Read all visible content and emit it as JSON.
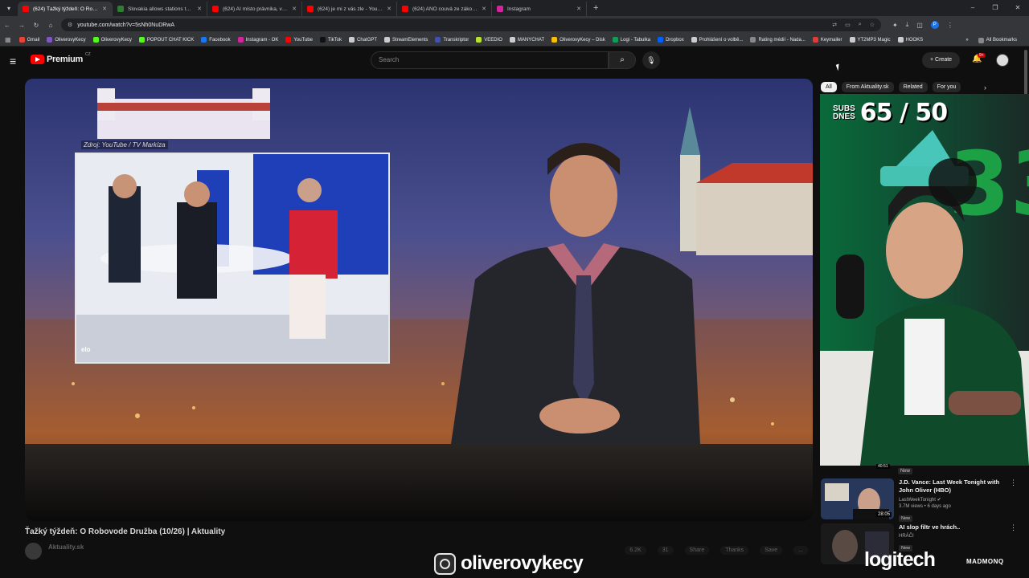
{
  "browser": {
    "tabs": [
      {
        "title": "(624) Ťažký týždeň: O Robovode",
        "color": "#ff0000",
        "active": true
      },
      {
        "title": "Slovakia allows stations to set",
        "color": "#2e7d32",
        "active": false
      },
      {
        "title": "(624) AI místo právnika, vyhoz",
        "color": "#ff0000",
        "active": false
      },
      {
        "title": "(624) je mi z vás zle - YouTube",
        "color": "#ff0000",
        "active": false
      },
      {
        "title": "(624) ANO couvá ze zákona o",
        "color": "#ff0000",
        "active": false
      },
      {
        "title": "Instagram",
        "color": "#d6249f",
        "active": false
      }
    ],
    "url": "youtube.com/watch?v=5sNh0NuDRwA",
    "profile_initial": "P",
    "bookmarks": [
      {
        "label": "Gmail",
        "color": "#ea4335"
      },
      {
        "label": "OliverovyKecy",
        "color": "#7e57c2"
      },
      {
        "label": "OliverovyKecy",
        "color": "#53fc18"
      },
      {
        "label": "POPOUT CHAT KICK",
        "color": "#53fc18"
      },
      {
        "label": "Facebook",
        "color": "#1877f2"
      },
      {
        "label": "Instagram - OK",
        "color": "#d6249f"
      },
      {
        "label": "YouTube",
        "color": "#ff0000"
      },
      {
        "label": "TikTok",
        "color": "#111111"
      },
      {
        "label": "ChatGPT",
        "color": "#cccccc"
      },
      {
        "label": "StreamElements",
        "color": "#cccccc"
      },
      {
        "label": "Transkriptor",
        "color": "#3f51b5"
      },
      {
        "label": "VEEDIO",
        "color": "#b7e32b"
      },
      {
        "label": "MANYCHAT",
        "color": "#cccccc"
      },
      {
        "label": "OliverovyKecy – Disk",
        "color": "#fbbc04"
      },
      {
        "label": "Logi - Tabulka",
        "color": "#0f9d58"
      },
      {
        "label": "Dropbox",
        "color": "#0061ff"
      },
      {
        "label": "Prohlášení o volbě...",
        "color": "#cccccc"
      },
      {
        "label": "Rating médií - Nada...",
        "color": "#888888"
      },
      {
        "label": "Keymailer",
        "color": "#e53935"
      },
      {
        "label": "YT2MP3 Magic",
        "color": "#cccccc"
      },
      {
        "label": "HOOKS",
        "color": "#cccccc"
      }
    ],
    "bookmarks_more": "»",
    "all_bookmarks": "All Bookmarks"
  },
  "youtube": {
    "brand": "Premium",
    "country": "CZ",
    "search_placeholder": "Search",
    "create_label": "Create",
    "notif_count": "9+",
    "chips": [
      "All",
      "From Aktuality.sk",
      "Related",
      "For you"
    ],
    "video": {
      "title": "Ťažký týždeň: O Robovode Družba (10/26) | Aktuality",
      "source_caption": "Zdroj: YouTube / TV Markíza",
      "inset_logo": "elo",
      "channel": "Aktuality.sk",
      "actions": [
        "6.2K",
        "31",
        "Share",
        "Thanks",
        "Save",
        "..."
      ]
    },
    "recommendations": [
      {
        "title": "J.D. Vance: Last Week Tonight with John Oliver (HBO)",
        "channel": "LastWeekTonight",
        "meta": "3.7M views • 6 days ago",
        "badge": "New",
        "duration": "28:05"
      },
      {
        "title": "AI slop filtr ve hrách..",
        "channel": "HRÁČI",
        "meta": "",
        "badge": "New",
        "duration": ""
      }
    ],
    "top_partial": {
      "duration": "40:51",
      "badge": "New"
    }
  },
  "overlay": {
    "subs_label_1": "SUBS",
    "subs_label_2": "DNES",
    "subs_count": "65 / 50",
    "handle": "oliverovykecy",
    "sponsor_1": "logitech",
    "sponsor_2": "MADMONQ"
  }
}
